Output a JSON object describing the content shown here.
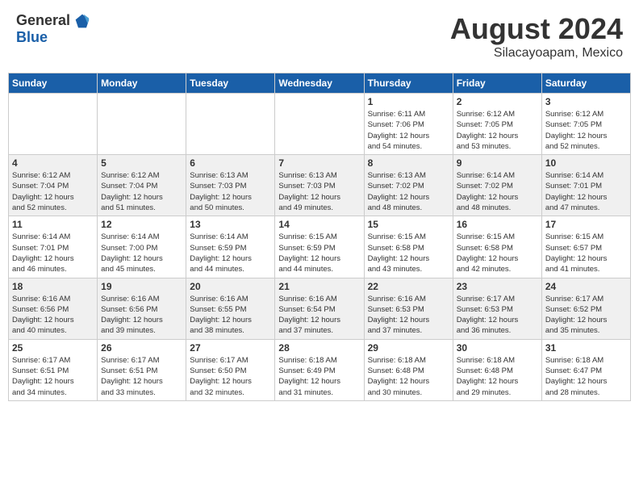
{
  "header": {
    "logo_general": "General",
    "logo_blue": "Blue",
    "month_title": "August 2024",
    "subtitle": "Silacayoapam, Mexico"
  },
  "calendar": {
    "days_of_week": [
      "Sunday",
      "Monday",
      "Tuesday",
      "Wednesday",
      "Thursday",
      "Friday",
      "Saturday"
    ],
    "weeks": [
      {
        "row_bg": "light",
        "days": [
          {
            "num": "",
            "info": ""
          },
          {
            "num": "",
            "info": ""
          },
          {
            "num": "",
            "info": ""
          },
          {
            "num": "",
            "info": ""
          },
          {
            "num": "1",
            "info": "Sunrise: 6:11 AM\nSunset: 7:06 PM\nDaylight: 12 hours\nand 54 minutes."
          },
          {
            "num": "2",
            "info": "Sunrise: 6:12 AM\nSunset: 7:05 PM\nDaylight: 12 hours\nand 53 minutes."
          },
          {
            "num": "3",
            "info": "Sunrise: 6:12 AM\nSunset: 7:05 PM\nDaylight: 12 hours\nand 52 minutes."
          }
        ]
      },
      {
        "row_bg": "dark",
        "days": [
          {
            "num": "4",
            "info": "Sunrise: 6:12 AM\nSunset: 7:04 PM\nDaylight: 12 hours\nand 52 minutes."
          },
          {
            "num": "5",
            "info": "Sunrise: 6:12 AM\nSunset: 7:04 PM\nDaylight: 12 hours\nand 51 minutes."
          },
          {
            "num": "6",
            "info": "Sunrise: 6:13 AM\nSunset: 7:03 PM\nDaylight: 12 hours\nand 50 minutes."
          },
          {
            "num": "7",
            "info": "Sunrise: 6:13 AM\nSunset: 7:03 PM\nDaylight: 12 hours\nand 49 minutes."
          },
          {
            "num": "8",
            "info": "Sunrise: 6:13 AM\nSunset: 7:02 PM\nDaylight: 12 hours\nand 48 minutes."
          },
          {
            "num": "9",
            "info": "Sunrise: 6:14 AM\nSunset: 7:02 PM\nDaylight: 12 hours\nand 48 minutes."
          },
          {
            "num": "10",
            "info": "Sunrise: 6:14 AM\nSunset: 7:01 PM\nDaylight: 12 hours\nand 47 minutes."
          }
        ]
      },
      {
        "row_bg": "light",
        "days": [
          {
            "num": "11",
            "info": "Sunrise: 6:14 AM\nSunset: 7:01 PM\nDaylight: 12 hours\nand 46 minutes."
          },
          {
            "num": "12",
            "info": "Sunrise: 6:14 AM\nSunset: 7:00 PM\nDaylight: 12 hours\nand 45 minutes."
          },
          {
            "num": "13",
            "info": "Sunrise: 6:14 AM\nSunset: 6:59 PM\nDaylight: 12 hours\nand 44 minutes."
          },
          {
            "num": "14",
            "info": "Sunrise: 6:15 AM\nSunset: 6:59 PM\nDaylight: 12 hours\nand 44 minutes."
          },
          {
            "num": "15",
            "info": "Sunrise: 6:15 AM\nSunset: 6:58 PM\nDaylight: 12 hours\nand 43 minutes."
          },
          {
            "num": "16",
            "info": "Sunrise: 6:15 AM\nSunset: 6:58 PM\nDaylight: 12 hours\nand 42 minutes."
          },
          {
            "num": "17",
            "info": "Sunrise: 6:15 AM\nSunset: 6:57 PM\nDaylight: 12 hours\nand 41 minutes."
          }
        ]
      },
      {
        "row_bg": "dark",
        "days": [
          {
            "num": "18",
            "info": "Sunrise: 6:16 AM\nSunset: 6:56 PM\nDaylight: 12 hours\nand 40 minutes."
          },
          {
            "num": "19",
            "info": "Sunrise: 6:16 AM\nSunset: 6:56 PM\nDaylight: 12 hours\nand 39 minutes."
          },
          {
            "num": "20",
            "info": "Sunrise: 6:16 AM\nSunset: 6:55 PM\nDaylight: 12 hours\nand 38 minutes."
          },
          {
            "num": "21",
            "info": "Sunrise: 6:16 AM\nSunset: 6:54 PM\nDaylight: 12 hours\nand 37 minutes."
          },
          {
            "num": "22",
            "info": "Sunrise: 6:16 AM\nSunset: 6:53 PM\nDaylight: 12 hours\nand 37 minutes."
          },
          {
            "num": "23",
            "info": "Sunrise: 6:17 AM\nSunset: 6:53 PM\nDaylight: 12 hours\nand 36 minutes."
          },
          {
            "num": "24",
            "info": "Sunrise: 6:17 AM\nSunset: 6:52 PM\nDaylight: 12 hours\nand 35 minutes."
          }
        ]
      },
      {
        "row_bg": "light",
        "days": [
          {
            "num": "25",
            "info": "Sunrise: 6:17 AM\nSunset: 6:51 PM\nDaylight: 12 hours\nand 34 minutes."
          },
          {
            "num": "26",
            "info": "Sunrise: 6:17 AM\nSunset: 6:51 PM\nDaylight: 12 hours\nand 33 minutes."
          },
          {
            "num": "27",
            "info": "Sunrise: 6:17 AM\nSunset: 6:50 PM\nDaylight: 12 hours\nand 32 minutes."
          },
          {
            "num": "28",
            "info": "Sunrise: 6:18 AM\nSunset: 6:49 PM\nDaylight: 12 hours\nand 31 minutes."
          },
          {
            "num": "29",
            "info": "Sunrise: 6:18 AM\nSunset: 6:48 PM\nDaylight: 12 hours\nand 30 minutes."
          },
          {
            "num": "30",
            "info": "Sunrise: 6:18 AM\nSunset: 6:48 PM\nDaylight: 12 hours\nand 29 minutes."
          },
          {
            "num": "31",
            "info": "Sunrise: 6:18 AM\nSunset: 6:47 PM\nDaylight: 12 hours\nand 28 minutes."
          }
        ]
      }
    ]
  }
}
